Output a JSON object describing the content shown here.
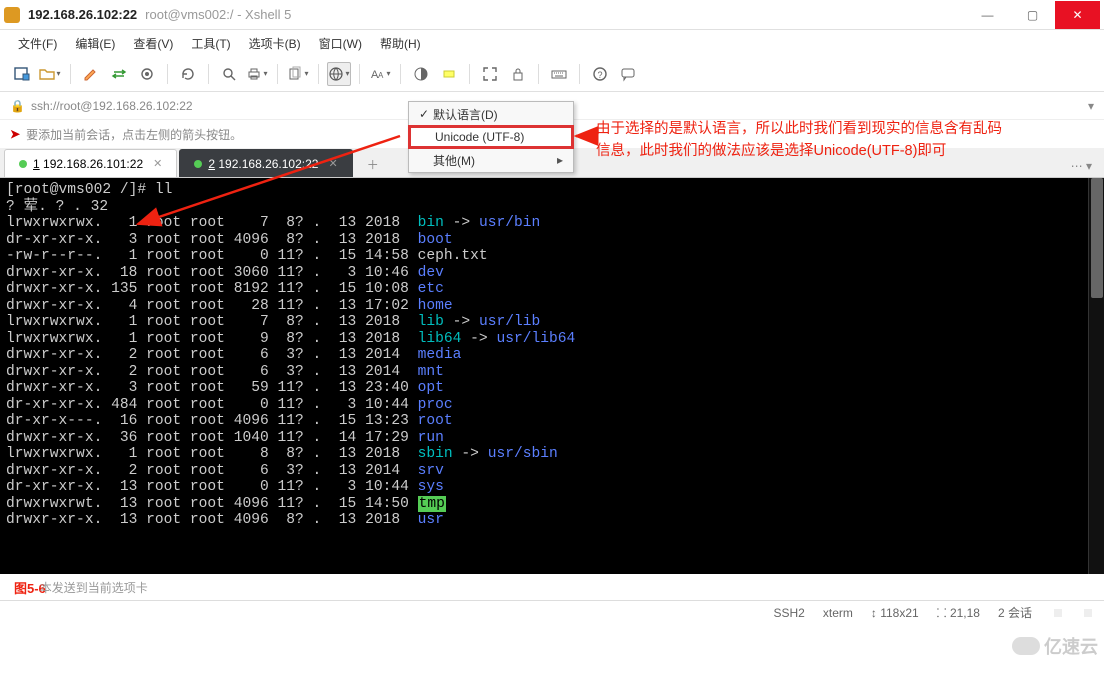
{
  "titlebar": {
    "main": "192.168.26.102:22",
    "sub": "root@vms002:/ - Xshell 5"
  },
  "menubar": [
    "文件(F)",
    "编辑(E)",
    "查看(V)",
    "工具(T)",
    "选项卡(B)",
    "窗口(W)",
    "帮助(H)"
  ],
  "addressbar": {
    "text": "ssh://root@192.168.26.102:22"
  },
  "hintbar": {
    "text": "要添加当前会话，点击左侧的箭头按钮。"
  },
  "tabs": {
    "items": [
      {
        "label": "1 192.168.26.101:22",
        "active": false
      },
      {
        "label": "2 192.168.26.102:22",
        "active": true
      }
    ]
  },
  "dropdown": {
    "items": [
      {
        "label": "默认语言(D)",
        "checked": true,
        "selected": false,
        "submenu": false
      },
      {
        "label": "Unicode (UTF-8)",
        "checked": false,
        "selected": true,
        "submenu": false
      },
      {
        "label": "其他(M)",
        "checked": false,
        "selected": false,
        "submenu": true
      }
    ]
  },
  "annotation": {
    "line1": "由于选择的是默认语言，所以此时我们看到现实的信息含有乱码",
    "line2": "信息，此时我们的做法应该是选择Unicode(UTF-8)即可"
  },
  "terminal": {
    "prompt": "[root@vms002 /]# ll",
    "header": "? 荤. ? . 32",
    "rows": [
      {
        "perm": "lrwxrwxrwx.",
        "n": "1",
        "u": "root",
        "g": "root",
        "sz": "7",
        "d1": "8?",
        "d2": ".",
        "d3": "13",
        "d4": "2018",
        "name": "bin",
        "link": " -> ",
        "target": "usr/bin",
        "cls": "c-cyan",
        "tcls": "c-blue"
      },
      {
        "perm": "dr-xr-xr-x.",
        "n": "3",
        "u": "root",
        "g": "root",
        "sz": "4096",
        "d1": "8?",
        "d2": ".",
        "d3": "13",
        "d4": "2018",
        "name": "boot",
        "cls": "c-blue"
      },
      {
        "perm": "-rw-r--r--.",
        "n": "1",
        "u": "root",
        "g": "root",
        "sz": "0",
        "d1": "11?",
        "d2": ".",
        "d3": "15",
        "d4": "14:58",
        "name": "ceph.txt",
        "cls": ""
      },
      {
        "perm": "drwxr-xr-x.",
        "n": "18",
        "u": "root",
        "g": "root",
        "sz": "3060",
        "d1": "11?",
        "d2": ".",
        "d3": "3",
        "d4": "10:46",
        "name": "dev",
        "cls": "c-blue"
      },
      {
        "perm": "drwxr-xr-x.",
        "n": "135",
        "u": "root",
        "g": "root",
        "sz": "8192",
        "d1": "11?",
        "d2": ".",
        "d3": "15",
        "d4": "10:08",
        "name": "etc",
        "cls": "c-blue"
      },
      {
        "perm": "drwxr-xr-x.",
        "n": "4",
        "u": "root",
        "g": "root",
        "sz": "28",
        "d1": "11?",
        "d2": ".",
        "d3": "13",
        "d4": "17:02",
        "name": "home",
        "cls": "c-blue"
      },
      {
        "perm": "lrwxrwxrwx.",
        "n": "1",
        "u": "root",
        "g": "root",
        "sz": "7",
        "d1": "8?",
        "d2": ".",
        "d3": "13",
        "d4": "2018",
        "name": "lib",
        "link": " -> ",
        "target": "usr/lib",
        "cls": "c-cyan",
        "tcls": "c-blue"
      },
      {
        "perm": "lrwxrwxrwx.",
        "n": "1",
        "u": "root",
        "g": "root",
        "sz": "9",
        "d1": "8?",
        "d2": ".",
        "d3": "13",
        "d4": "2018",
        "name": "lib64",
        "link": " -> ",
        "target": "usr/lib64",
        "cls": "c-cyan",
        "tcls": "c-blue"
      },
      {
        "perm": "drwxr-xr-x.",
        "n": "2",
        "u": "root",
        "g": "root",
        "sz": "6",
        "d1": "3?",
        "d2": ".",
        "d3": "13",
        "d4": "2014",
        "name": "media",
        "cls": "c-blue"
      },
      {
        "perm": "drwxr-xr-x.",
        "n": "2",
        "u": "root",
        "g": "root",
        "sz": "6",
        "d1": "3?",
        "d2": ".",
        "d3": "13",
        "d4": "2014",
        "name": "mnt",
        "cls": "c-blue"
      },
      {
        "perm": "drwxr-xr-x.",
        "n": "3",
        "u": "root",
        "g": "root",
        "sz": "59",
        "d1": "11?",
        "d2": ".",
        "d3": "13",
        "d4": "23:40",
        "name": "opt",
        "cls": "c-blue"
      },
      {
        "perm": "dr-xr-xr-x.",
        "n": "484",
        "u": "root",
        "g": "root",
        "sz": "0",
        "d1": "11?",
        "d2": ".",
        "d3": "3",
        "d4": "10:44",
        "name": "proc",
        "cls": "c-blue"
      },
      {
        "perm": "dr-xr-x---.",
        "n": "16",
        "u": "root",
        "g": "root",
        "sz": "4096",
        "d1": "11?",
        "d2": ".",
        "d3": "15",
        "d4": "13:23",
        "name": "root",
        "cls": "c-blue"
      },
      {
        "perm": "drwxr-xr-x.",
        "n": "36",
        "u": "root",
        "g": "root",
        "sz": "1040",
        "d1": "11?",
        "d2": ".",
        "d3": "14",
        "d4": "17:29",
        "name": "run",
        "cls": "c-blue"
      },
      {
        "perm": "lrwxrwxrwx.",
        "n": "1",
        "u": "root",
        "g": "root",
        "sz": "8",
        "d1": "8?",
        "d2": ".",
        "d3": "13",
        "d4": "2018",
        "name": "sbin",
        "link": " -> ",
        "target": "usr/sbin",
        "cls": "c-cyan",
        "tcls": "c-blue"
      },
      {
        "perm": "drwxr-xr-x.",
        "n": "2",
        "u": "root",
        "g": "root",
        "sz": "6",
        "d1": "3?",
        "d2": ".",
        "d3": "13",
        "d4": "2014",
        "name": "srv",
        "cls": "c-blue"
      },
      {
        "perm": "dr-xr-xr-x.",
        "n": "13",
        "u": "root",
        "g": "root",
        "sz": "0",
        "d1": "11?",
        "d2": ".",
        "d3": "3",
        "d4": "10:44",
        "name": "sys",
        "cls": "c-blue"
      },
      {
        "perm": "drwxrwxrwt.",
        "n": "13",
        "u": "root",
        "g": "root",
        "sz": "4096",
        "d1": "11?",
        "d2": ".",
        "d3": "15",
        "d4": "14:50",
        "name": "tmp",
        "cls": "c-hl"
      },
      {
        "perm": "drwxr-xr-x.",
        "n": "13",
        "u": "root",
        "g": "root",
        "sz": "4096",
        "d1": "8?",
        "d2": ".",
        "d3": "13",
        "d4": "2018",
        "name": "usr",
        "cls": "c-blue"
      }
    ]
  },
  "bottom": {
    "redlabel": "图5-6",
    "hint": "本发送到当前选项卡"
  },
  "statusbar": {
    "items": [
      "SSH2",
      "xterm",
      "↕ 118x21",
      "⸬ 21,18",
      "2 会话"
    ]
  },
  "watermark": "亿速云"
}
